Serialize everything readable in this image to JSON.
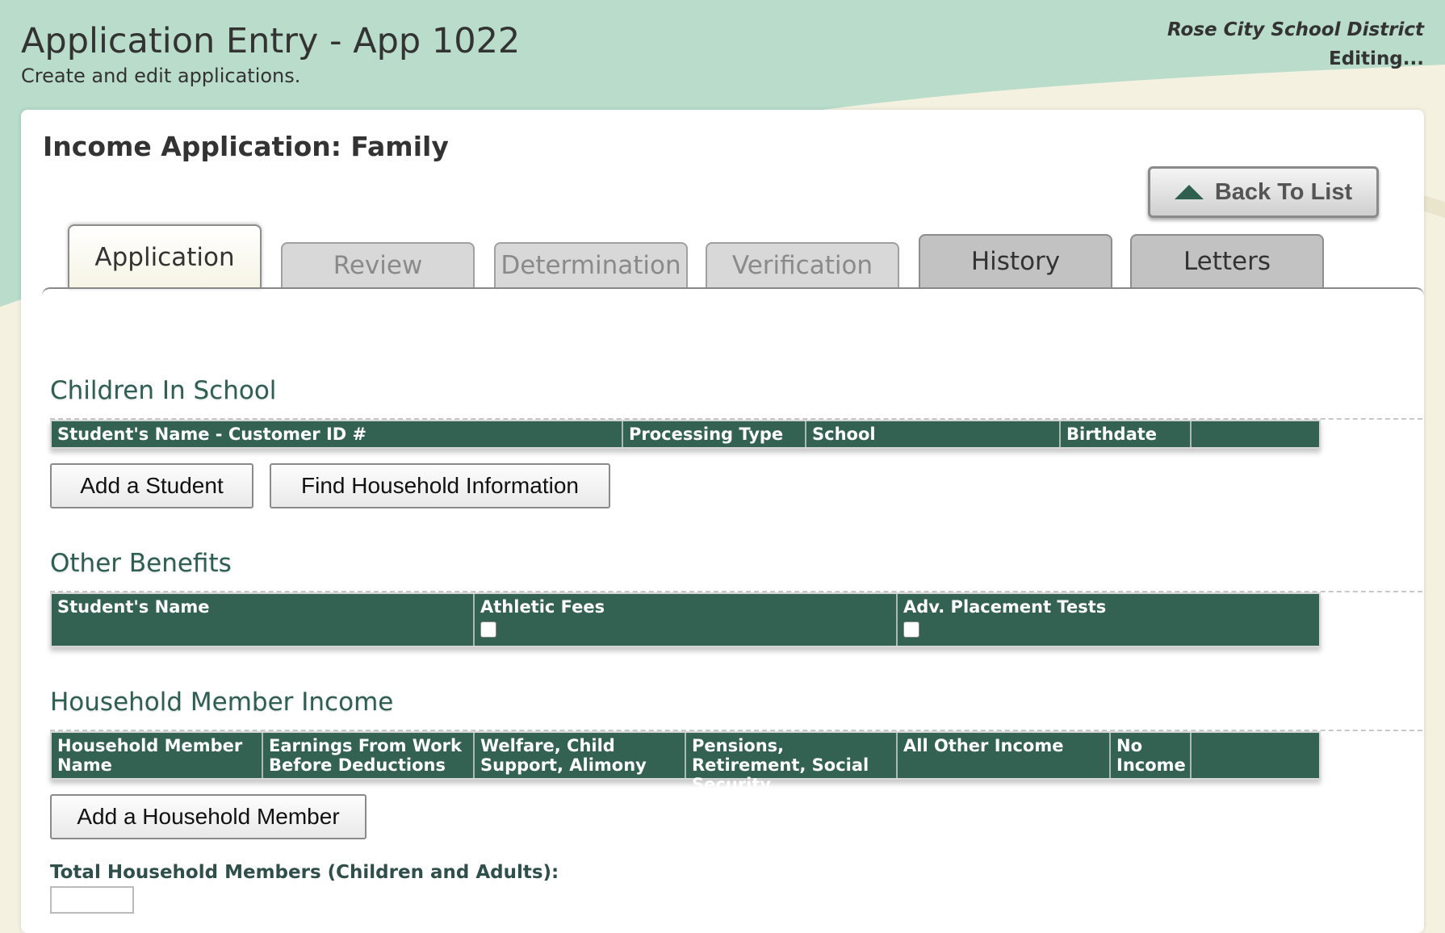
{
  "header": {
    "title": "Application Entry - App 1022",
    "subtitle": "Create and edit applications.",
    "district": "Rose City School District",
    "status": "Editing..."
  },
  "card": {
    "heading": "Income Application: Family",
    "back_button": "Back To List"
  },
  "tabs": [
    {
      "label": "Application",
      "state": "active"
    },
    {
      "label": "Review",
      "state": "disabled"
    },
    {
      "label": "Determination",
      "state": "disabled"
    },
    {
      "label": "Verification",
      "state": "disabled"
    },
    {
      "label": "History",
      "state": "enabled"
    },
    {
      "label": "Letters",
      "state": "enabled"
    }
  ],
  "children": {
    "title": "Children In School",
    "columns": [
      "Student's Name - Customer ID #",
      "Processing Type",
      "School",
      "Birthdate",
      ""
    ],
    "add_student": "Add a Student",
    "find_household": "Find Household Information"
  },
  "benefits": {
    "title": "Other Benefits",
    "columns": [
      "Student's Name",
      "Athletic Fees",
      "Adv. Placement Tests"
    ],
    "athletic_fees_checked": false,
    "adv_placement_checked": false
  },
  "income": {
    "title": "Household Member Income",
    "columns": [
      "Household Member Name",
      "Earnings From Work Before Deductions",
      "Welfare, Child Support, Alimony",
      "Pensions, Retirement, Social Security",
      "All Other Income",
      "No Income",
      ""
    ],
    "add_member": "Add a Household Member"
  },
  "total": {
    "label": "Total Household Members (Children and Adults):",
    "value": ""
  },
  "colors": {
    "header_band": "#b9dccb",
    "grid_header": "#336253",
    "section_title": "#2f5f52",
    "accent_triangle": "#2f5f4f"
  }
}
